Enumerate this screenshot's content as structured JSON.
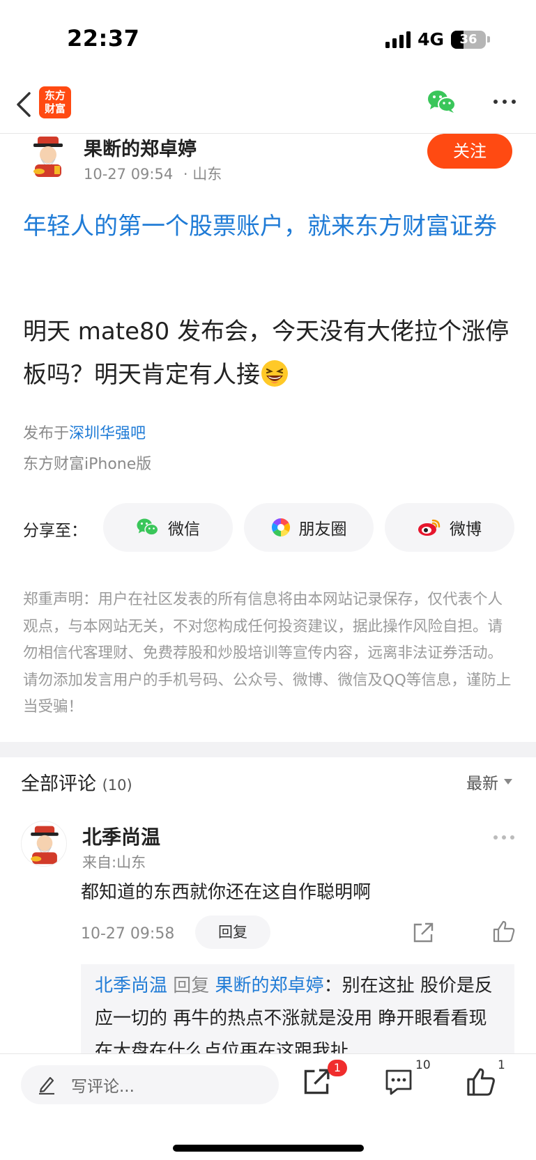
{
  "status_bar": {
    "time": "22:37",
    "network": "4G",
    "battery": "36"
  },
  "nav": {
    "logo_line1": "东方",
    "logo_line2": "财富"
  },
  "author": {
    "name": "果断的郑卓婷",
    "date": "10-27 09:54",
    "location": "· 山东",
    "follow_label": "关注"
  },
  "ad_link": "年轻人的第一个股票账户，就来东方财富证券",
  "post": {
    "text": "明天 mate80 发布会，今天没有大佬拉个涨停板吗？明天肯定有人接"
  },
  "published": {
    "prefix": "发布于",
    "bar_name": "深圳华强吧"
  },
  "source": "东方财富iPhone版",
  "share": {
    "label": "分享至：",
    "wechat": "微信",
    "moments": "朋友圈",
    "weibo": "微博"
  },
  "disclaimer": "郑重声明：用户在社区发表的所有信息将由本网站记录保存，仅代表个人观点，与本网站无关，不对您构成任何投资建议，据此操作风险自担。请勿相信代客理财、免费荐股和炒股培训等宣传内容，远离非法证券活动。请勿添加发言用户的手机号码、公众号、微博、微信及QQ等信息，谨防上当受骗！",
  "comments": {
    "title": "全部评论",
    "count": "(10)",
    "sort_label": "最新",
    "items": [
      {
        "name": "北季尚温",
        "location": "来自:山东",
        "text": "都知道的东西就你还在这自作聪明啊",
        "time": "10-27 09:58",
        "reply_label": "回复"
      }
    ],
    "reply": {
      "from": "北季尚温",
      "verb": " 回复 ",
      "to": "果断的郑卓婷",
      "text": "：别在这扯 股价是反应一切的 再牛的热点不涨就是没用 睁开眼看看现在大盘在什么点位再在这跟我扯"
    }
  },
  "bottom_bar": {
    "input_placeholder": "写评论...",
    "share_badge": "1",
    "comment_count": "10",
    "like_count": "1"
  },
  "colors": {
    "accent": "#ff4a12",
    "link": "#1f7bd6",
    "badge": "#f02d2d"
  }
}
